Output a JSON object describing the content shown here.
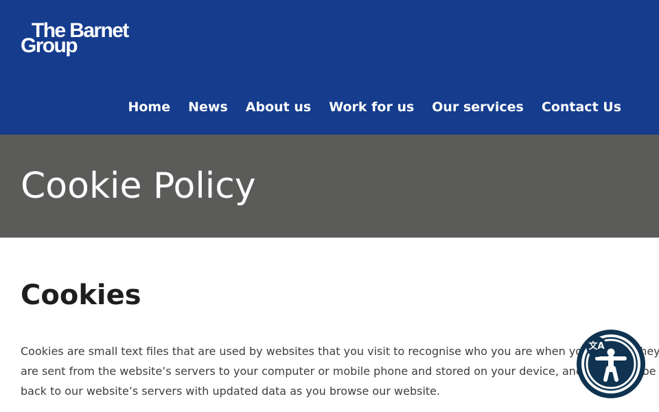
{
  "header": {
    "logo_line1": "The Barnet",
    "logo_line2": "Group",
    "nav": [
      {
        "label": "Home"
      },
      {
        "label": "News"
      },
      {
        "label": "About us"
      },
      {
        "label": "Work for us"
      },
      {
        "label": "Our services"
      },
      {
        "label": "Contact Us"
      }
    ],
    "background_color": "#153c8d"
  },
  "hero": {
    "title": "Cookie Policy",
    "background_color": "#5b5b5a"
  },
  "content": {
    "heading": "Cookies",
    "paragraph_lines": [
      "Cookies are small text files that are used by websites that you visit to recognise who you are when you return. They",
      "are sent from the website’s servers to your computer or mobile phone and stored on your device, and may then be sent",
      "back to our website’s servers with updated data as you browse our website."
    ]
  },
  "accessibility_widget": {
    "icon": "accessibility-person-icon",
    "badge_icon": "translate-icon",
    "badge_text": "文A",
    "color": "#0f3350"
  }
}
